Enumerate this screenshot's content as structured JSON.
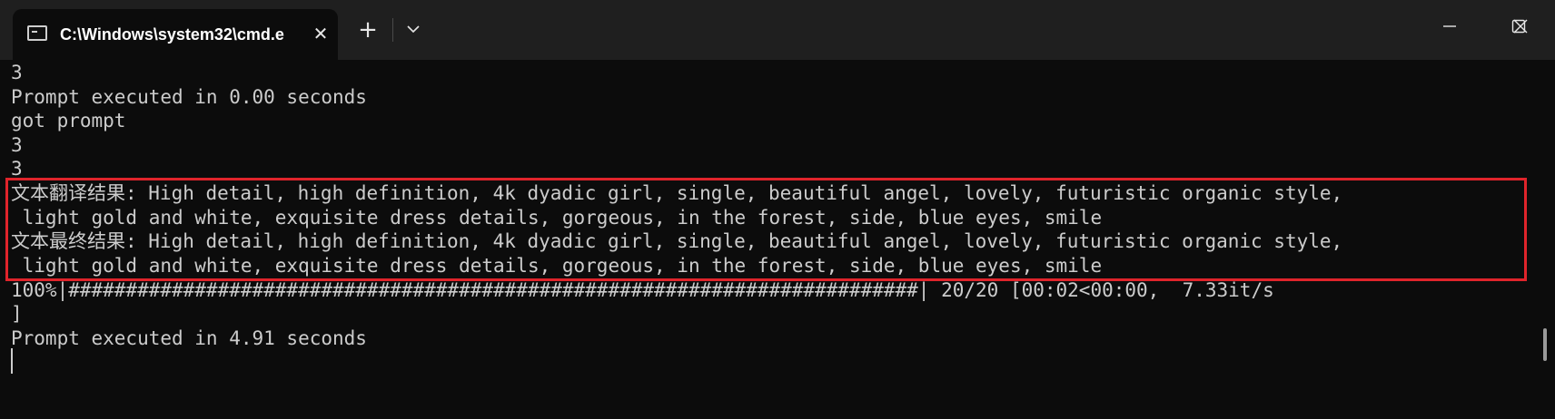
{
  "titlebar": {
    "tab_title": "C:\\Windows\\system32\\cmd.e",
    "close_glyph": "✕",
    "new_tab_glyph": "+"
  },
  "icons": {
    "tab": "terminal-icon",
    "dropdown": "chevron-down-icon",
    "minimize": "minimize-icon",
    "maximize": "maximize-icon",
    "close": "close-icon"
  },
  "console": {
    "lines": [
      "3",
      "Prompt executed in 0.00 seconds",
      "got prompt",
      "3",
      "3",
      "文本翻译结果: High detail, high definition, 4k dyadic girl, single, beautiful angel, lovely, futuristic organic style,",
      " light gold and white, exquisite dress details, gorgeous, in the forest, side, blue eyes, smile",
      "文本最终结果: High detail, high definition, 4k dyadic girl, single, beautiful angel, lovely, futuristic organic style,",
      " light gold and white, exquisite dress details, gorgeous, in the forest, side, blue eyes, smile",
      "100%|##########################################################################| 20/20 [00:02<00:00,  7.33it/s",
      "]",
      "Prompt executed in 4.91 seconds"
    ]
  },
  "colors": {
    "background": "#0c0c0c",
    "titlebar": "#1f1f1f",
    "text": "#cccccc",
    "highlight_border": "#e0242b"
  }
}
